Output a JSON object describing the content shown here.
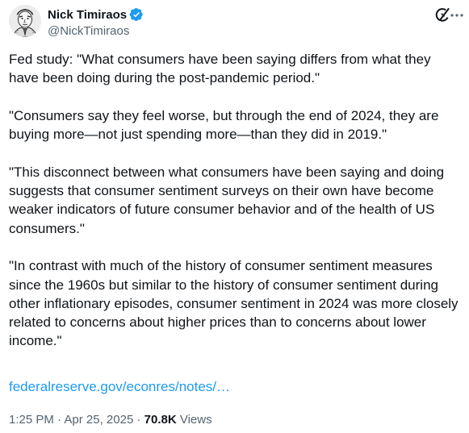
{
  "author": {
    "display_name": "Nick Timiraos",
    "handle": "@NickTimiraos",
    "verified": true,
    "avatar_icon": "sketch-portrait-avatar"
  },
  "actions": {
    "grok_icon": "grok-icon",
    "more_icon": "more-dots-icon"
  },
  "tweet": {
    "paragraphs": [
      "Fed study: \"What consumers have been saying differs from what they have been doing during the post-pandemic period.\"",
      "\"Consumers say they feel worse, but through the end of 2024, they are buying more—not just spending more—than they did in 2019.\"",
      "\"This disconnect between what consumers have been saying and doing suggests that consumer sentiment surveys on their own have become weaker indicators of future consumer behavior and of the health of US consumers.\"",
      "\"In contrast with much of the history of consumer sentiment measures since the 1960s but similar to the history of consumer sentiment during other inflationary episodes, consumer sentiment in 2024 was more closely related to concerns about higher prices than to concerns about lower income.\""
    ],
    "link_text": "federalreserve.gov/econres/notes/…"
  },
  "meta": {
    "time": "1:25 PM",
    "separator": " · ",
    "date": "Apr 25, 2025",
    "views_count": "70.8K",
    "views_label": " Views"
  },
  "colors": {
    "text": "#0f1419",
    "secondary": "#536471",
    "link": "#1d9bf0",
    "verified": "#1d9bf0"
  }
}
